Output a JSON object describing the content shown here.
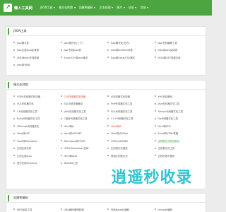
{
  "header": {
    "brand": "懒人工具网",
    "nav": [
      {
        "label": "JSON工具"
      },
      {
        "label": "格式化转换"
      },
      {
        "label": "加解密编码"
      },
      {
        "label": "文本处理"
      },
      {
        "label": "图片"
      },
      {
        "label": "站长"
      },
      {
        "label": "其他"
      }
    ]
  },
  "section_json": {
    "title": "JSON工具",
    "items": [
      {
        "label": "Json格式化",
        "tone": "normal"
      },
      {
        "label": "Json格式化(上下)",
        "tone": "normal"
      },
      {
        "label": "Json格式化(左右)",
        "tone": "normal"
      },
      {
        "label": "Json在线编辑工具",
        "tone": "normal"
      },
      {
        "label": "Json生成Java实体类",
        "tone": "normal"
      },
      {
        "label": "Json在线Java类",
        "tone": "normal"
      },
      {
        "label": "Json转JavaScript类",
        "tone": "normal"
      },
      {
        "label": "SQL转Java实体类",
        "tone": "normal"
      },
      {
        "label": "XML转Json在线转换",
        "tone": "normal"
      },
      {
        "label": "Excel/CSV转Json格式",
        "tone": "normal"
      },
      {
        "label": "Json转Excel/CSV格式",
        "tone": "normal"
      },
      {
        "label": "JSON转GET参数互转",
        "tone": "normal"
      },
      {
        "label": "Json转YAML",
        "tone": "normal"
      }
    ]
  },
  "section_format": {
    "title": "格式化转换",
    "items": [
      {
        "label": "HTML在线格式化压缩",
        "tone": "normal"
      },
      {
        "label": "CSS在线格式化压缩",
        "tone": "red"
      },
      {
        "label": "JS在线格式化压缩",
        "tone": "normal"
      },
      {
        "label": "XML在线美化",
        "tone": "normal"
      },
      {
        "label": "SQL在线格式化",
        "tone": "normal"
      },
      {
        "label": "SQL在线压缩格式",
        "tone": "normal"
      },
      {
        "label": "PHP在线格式化工具",
        "tone": "normal"
      },
      {
        "label": "Java在线格式化工具",
        "tone": "normal"
      },
      {
        "label": "C#在线格式化工具",
        "tone": "normal"
      },
      {
        "label": "JAVA在线格式化工具",
        "tone": "normal"
      },
      {
        "label": "SQL代码格式化工具",
        "tone": "normal"
      },
      {
        "label": "Python代码格式化工具",
        "tone": "normal"
      },
      {
        "label": "Ruby代码格式化工具",
        "tone": "normal"
      },
      {
        "label": "C语言代码格式化工具",
        "tone": "normal"
      },
      {
        "label": "C++代码格式化工具",
        "tone": "normal"
      },
      {
        "label": "Go代码格式化工具",
        "tone": "normal"
      },
      {
        "label": "VBScript代码格式化",
        "tone": "normal"
      },
      {
        "label": "Html转Js",
        "tone": "normal"
      },
      {
        "label": "Html转JS",
        "tone": "red"
      },
      {
        "label": "Html转PHP",
        "tone": "normal"
      },
      {
        "label": "Html转ASP",
        "tone": "normal"
      },
      {
        "label": "Html转ASP.NET",
        "tone": "normal"
      },
      {
        "label": "Html转JSP/Perl",
        "tone": "normal"
      },
      {
        "label": "Excel转HTML表格",
        "tone": "normal"
      },
      {
        "label": "Html转Markdown",
        "tone": "normal"
      },
      {
        "label": "Markdown转HTML",
        "tone": "normal"
      },
      {
        "label": "HTML/XML转义",
        "tone": "normal"
      },
      {
        "label": "正则表达式在线测试",
        "tone": "green"
      },
      {
        "label": "正则生成代码",
        "tone": "normal"
      },
      {
        "label": "HTML/Markdown互转",
        "tone": "normal"
      },
      {
        "label": "正则表达式速查",
        "tone": "normal"
      },
      {
        "label": "正则表达式工具",
        "tone": "normal"
      },
      {
        "label": "正则生成Java",
        "tone": "normal"
      },
      {
        "label": "Html转Java",
        "tone": "normal"
      },
      {
        "label": "常用正则表达式",
        "tone": "normal"
      },
      {
        "label": "正则在线可视化",
        "tone": "normal"
      },
      {
        "label": "进行在线Html/css",
        "tone": "normal"
      },
      {
        "label": "Base64工具",
        "tone": "normal"
      }
    ]
  },
  "section_encode": {
    "title": "加解密编码",
    "items": [
      {
        "label": "MD5加密工具",
        "tone": "normal"
      },
      {
        "label": "URL编码/解码转换",
        "tone": "normal"
      },
      {
        "label": "在线Base64编码",
        "tone": "normal"
      },
      {
        "label": "Unicode编码",
        "tone": "normal"
      }
    ]
  },
  "watermark": {
    "text": "逍遥秒收录"
  },
  "colors": {
    "brand_green": "#4ca640",
    "accent_red": "#e03c2e",
    "accent_green": "#2e9a3a",
    "watermark": "#20c0ce"
  }
}
